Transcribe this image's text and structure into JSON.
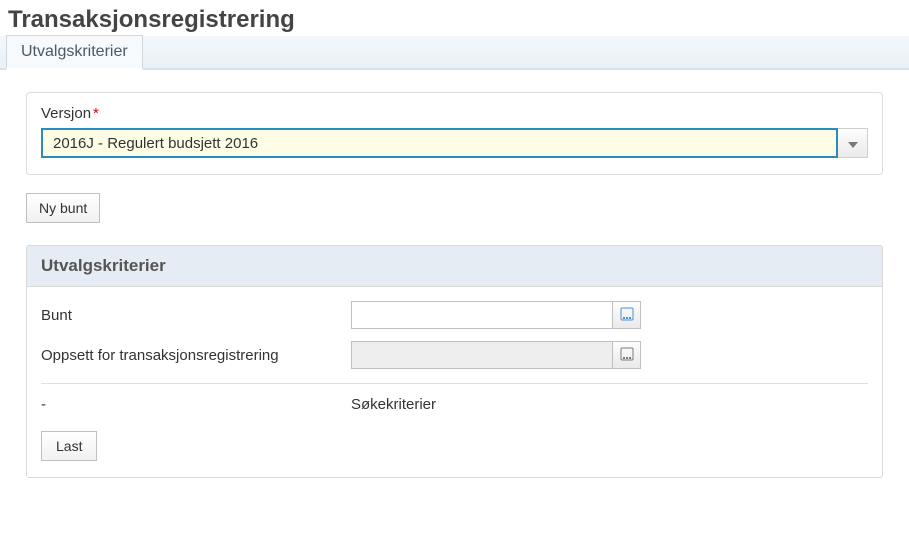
{
  "page_title": "Transaksjonsregistrering",
  "tabs": [
    {
      "label": "Utvalgskriterier"
    }
  ],
  "version": {
    "label": "Versjon",
    "required_marker": "*",
    "value": "2016J - Regulert budsjett 2016"
  },
  "buttons": {
    "new_bunt": "Ny bunt",
    "load": "Last"
  },
  "panel": {
    "title": "Utvalgskriterier",
    "fields": {
      "bunt": {
        "label": "Bunt",
        "value": ""
      },
      "oppsett": {
        "label": "Oppsett for transaksjonsregistrering",
        "value": ""
      }
    },
    "search": {
      "dash": "-",
      "label": "Søkekriterier"
    }
  }
}
